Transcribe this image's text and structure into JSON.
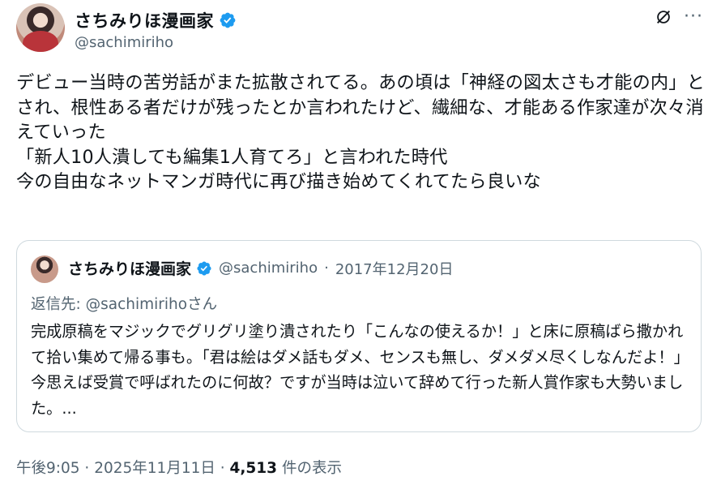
{
  "author": {
    "display_name": "さちみりほ漫画家",
    "handle": "@sachimiriho",
    "avatar_icon": "avatar-image",
    "verified_icon": "verified-badge-icon",
    "verified_color": "#1d9bf0"
  },
  "actions": {
    "grok_icon": "grok-icon",
    "more_label": "···"
  },
  "tweet": {
    "text": "デビュー当時の苦労話がまた拡散されてる。あの頃は「神経の図太さも才能の内」とされ、根性ある者だけが残ったとか言われたけど、繊細な、才能ある作家達が次々消えていった\n「新人10人潰しても編集1人育てろ」と言われた時代\n今の自由なネットマンガ時代に再び描き始めてくれてたら良いな"
  },
  "quote": {
    "display_name": "さちみりほ漫画家",
    "handle": "@sachimiriho",
    "separator": "·",
    "date": "2017年12月20日",
    "reply_prefix": "返信先: ",
    "reply_mention": "@sachimiriho",
    "reply_suffix": "さん",
    "text": "完成原稿をマジックでグリグリ塗り潰されたり「こんなの使えるか！」と床に原稿ばら撒かれて拾い集めて帰る事も。「君は絵はダメ話もダメ、センスも無し、ダメダメ尽くしなんだよ！」今思えば受賞で呼ばれたのに何故？ですが当時は泣いて辞めて行った新人賞作家も大勢いました。..."
  },
  "meta": {
    "time": "午後9:05",
    "sep1": " · ",
    "date": "2025年11月11日",
    "sep2": " · ",
    "views_count": "4,513",
    "views_label": " 件の表示"
  }
}
